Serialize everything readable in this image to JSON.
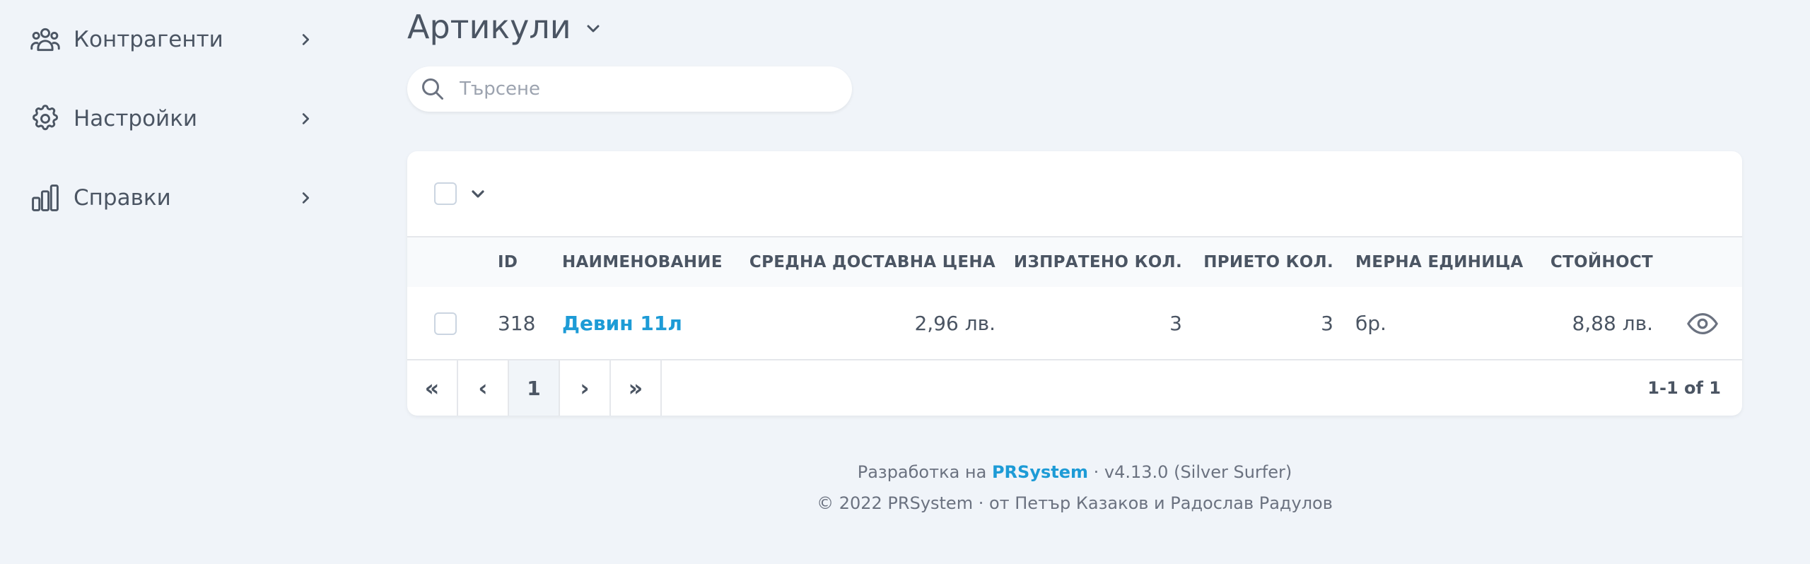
{
  "sidebar": {
    "items": [
      {
        "label": "Контрагенти",
        "icon": "users-icon"
      },
      {
        "label": "Настройки",
        "icon": "gear-icon"
      },
      {
        "label": "Справки",
        "icon": "chart-bars-icon"
      }
    ]
  },
  "header": {
    "title": "Артикули"
  },
  "search": {
    "placeholder": "Търсене",
    "value": ""
  },
  "table": {
    "columns": {
      "id": "ID",
      "name": "НАИМЕНОВАНИЕ",
      "avg_price": "СРЕДНА ДОСТАВНА ЦЕНА",
      "sent_qty": "ИЗПРАТЕНО КОЛ.",
      "received_qty": "ПРИЕТО КОЛ.",
      "unit": "МЕРНА ЕДИНИЦА",
      "value": "СТОЙНОСТ"
    },
    "rows": [
      {
        "id": "318",
        "name": "Девин 11л",
        "avg_price": "2,96 лв.",
        "sent_qty": "3",
        "received_qty": "3",
        "unit": "бр.",
        "value": "8,88 лв."
      }
    ]
  },
  "pagination": {
    "first": "«",
    "prev": "‹",
    "current": "1",
    "next": "›",
    "last": "»",
    "info": "1-1 of 1"
  },
  "footer": {
    "line1_prefix": "Разработка на",
    "line1_brand": "PRSystem",
    "line1_suffix": "· v4.13.0 (Silver Surfer)",
    "line2": "© 2022 PRSystem · от Петър Казаков и Радослав Радулов"
  },
  "colors": {
    "background": "#f0f4f9",
    "accent": "#1d9bd6",
    "text": "#4b5563"
  }
}
